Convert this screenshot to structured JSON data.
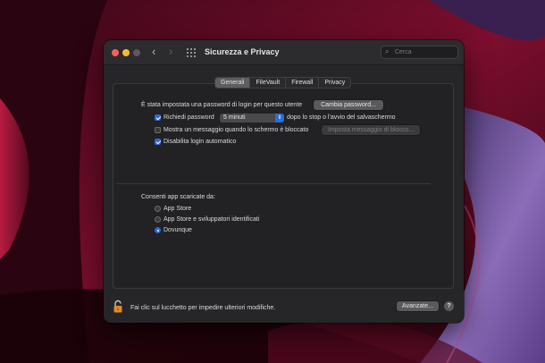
{
  "window": {
    "title": "Sicurezza e Privacy",
    "search_placeholder": "Cerca"
  },
  "tabs": [
    {
      "label": "Generali",
      "active": true
    },
    {
      "label": "FileVault",
      "active": false
    },
    {
      "label": "Firewall",
      "active": false
    },
    {
      "label": "Privacy",
      "active": false
    }
  ],
  "general": {
    "password_set_text": "È stata impostata una password di login per questo utente",
    "change_password_button": "Cambia password...",
    "require_password": {
      "label": "Richiedi password",
      "checked": true,
      "interval": "5 minuti",
      "suffix": "dopo lo stop o l'avvio del salvaschermo"
    },
    "show_message": {
      "label": "Mostra un messaggio quando lo schermo è bloccato",
      "checked": false,
      "button": "Imposta messaggio di blocco..."
    },
    "disable_auto_login": {
      "label": "Disabilita login automatico",
      "checked": true
    }
  },
  "downloads": {
    "heading": "Consenti app scaricate da:",
    "options": [
      {
        "label": "App Store",
        "selected": false
      },
      {
        "label": "App Store e sviluppatori identificati",
        "selected": false
      },
      {
        "label": "Dovunque",
        "selected": true
      }
    ]
  },
  "footer": {
    "lock_text": "Fai clic sul lucchetto per impedire ulteriori modifiche.",
    "advanced_button": "Avanzate...",
    "help_label": "?"
  },
  "colors": {
    "accent": "#2c6bd8",
    "window_bg": "#262527",
    "lock": "#e08a2c"
  },
  "icons": {
    "lock": "padlock-open-icon",
    "search": "magnifier-icon",
    "grid": "grid-icon"
  }
}
